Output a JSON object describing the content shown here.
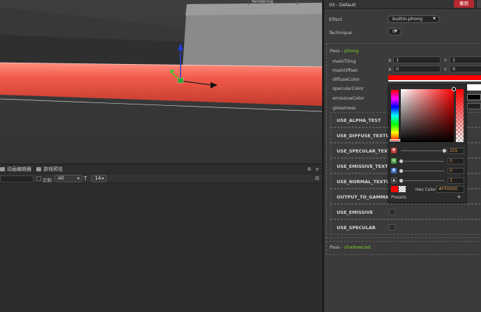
{
  "scene": {
    "tab_rendering": "Rendering",
    "tab_extra": ""
  },
  "bottom": {
    "tab_anim": "动画编辑器",
    "tab_preview": "游戏预览",
    "toolbar": {
      "checkbox_label": "正则",
      "filter_value": "All",
      "font_icon": "T",
      "font_size": "14"
    }
  },
  "inspector": {
    "title": "03 - Default",
    "revert_button": "撤销",
    "effect_label": "Effect",
    "effect_value": "builtin-phong",
    "technique_label": "Technique",
    "technique_value": "0",
    "pass1": {
      "prefix": "Pass - ",
      "name": "phong",
      "props": [
        {
          "label": "mainTiling",
          "x": "1",
          "y": "1"
        },
        {
          "label": "mainOffset",
          "x": "0",
          "y": "0"
        }
      ],
      "diffuse_label": "diffuseColor",
      "diffuse_color": "#FF0000",
      "specular_label": "specularColor",
      "emissive_label": "emissiveColor",
      "gloss_label": "glossiness",
      "axis_x": "X",
      "axis_y": "Y"
    },
    "defines": [
      "USE_ALPHA_TEST",
      "USE_DIFFUSE_TEXTURE",
      "USE_SPECULAR_TEXT...",
      "USE_EMISSIVE_TEXTU...",
      "USE_NORMAL_TEXTURE",
      "OUTPUT_TO_GAMMA",
      "USE_EMISSIVE",
      "USE_SPECULAR"
    ],
    "pass2": {
      "prefix": "Pass - ",
      "name": "shadowcast"
    }
  },
  "picker": {
    "channels": [
      {
        "label": "R",
        "value": "255",
        "fraction": 1.0,
        "color": "#c23b3b"
      },
      {
        "label": "G",
        "value": "0",
        "fraction": 0.0,
        "color": "#4b9a3f"
      },
      {
        "label": "B",
        "value": "0",
        "fraction": 0.0,
        "color": "#3b6ec2"
      },
      {
        "label": "A",
        "value": "3",
        "fraction": 0.0,
        "color": "#1e1e1e"
      }
    ],
    "hex_label": "Hex Color",
    "hex_value": "#FF0000",
    "presets_label": "Presets",
    "presets_add": "+"
  },
  "colors": {
    "accent_green": "#7ed321",
    "revert_red": "#b7282e",
    "value_orange": "#e2a04f"
  }
}
